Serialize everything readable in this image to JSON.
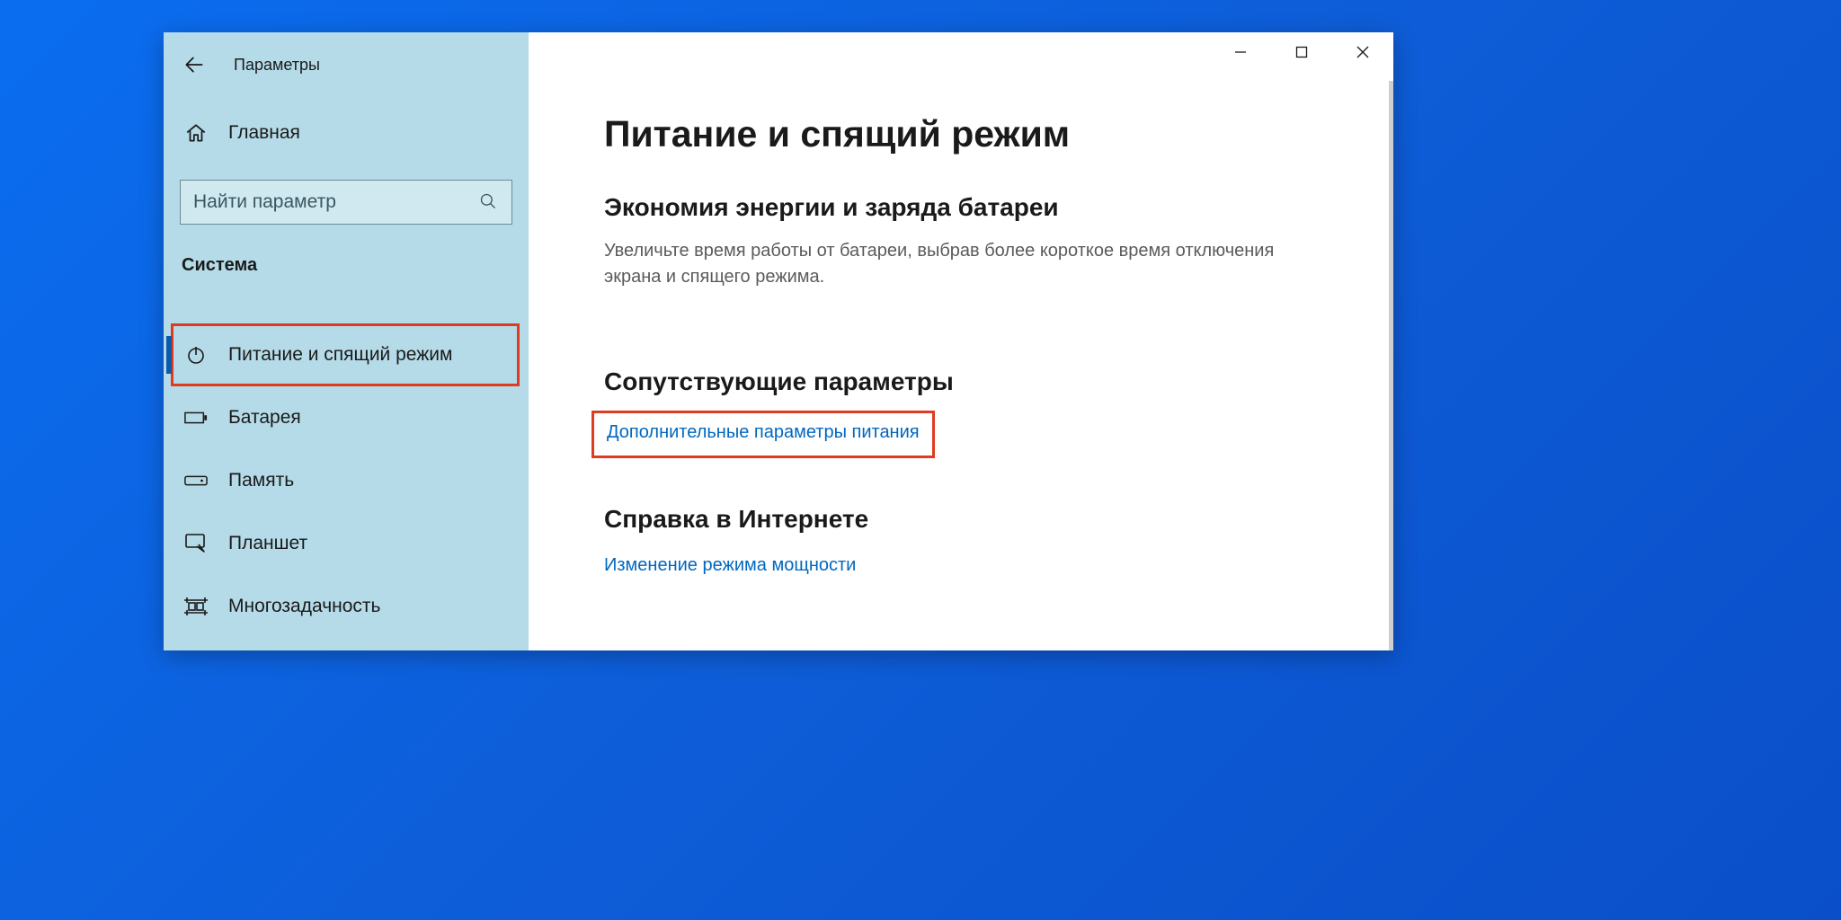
{
  "header": {
    "app_title": "Параметры"
  },
  "sidebar": {
    "home_label": "Главная",
    "search_placeholder": "Найти параметр",
    "category": "Система",
    "items": [
      {
        "icon": "power-icon",
        "label": "Питание и спящий режим",
        "active": true,
        "highlighted": true
      },
      {
        "icon": "battery-icon",
        "label": "Батарея"
      },
      {
        "icon": "storage-icon",
        "label": "Память"
      },
      {
        "icon": "tablet-icon",
        "label": "Планшет"
      },
      {
        "icon": "multitask-icon",
        "label": "Многозадачность"
      }
    ]
  },
  "main": {
    "title": "Питание и спящий режим",
    "section1_title": "Экономия энергии и заряда батареи",
    "section1_body": "Увеличьте время работы от батареи, выбрав более короткое время отключения экрана и спящего режима.",
    "section2_title": "Сопутствующие параметры",
    "section2_link": "Дополнительные параметры питания",
    "section3_title": "Справка в Интернете",
    "section3_link": "Изменение режима мощности"
  }
}
